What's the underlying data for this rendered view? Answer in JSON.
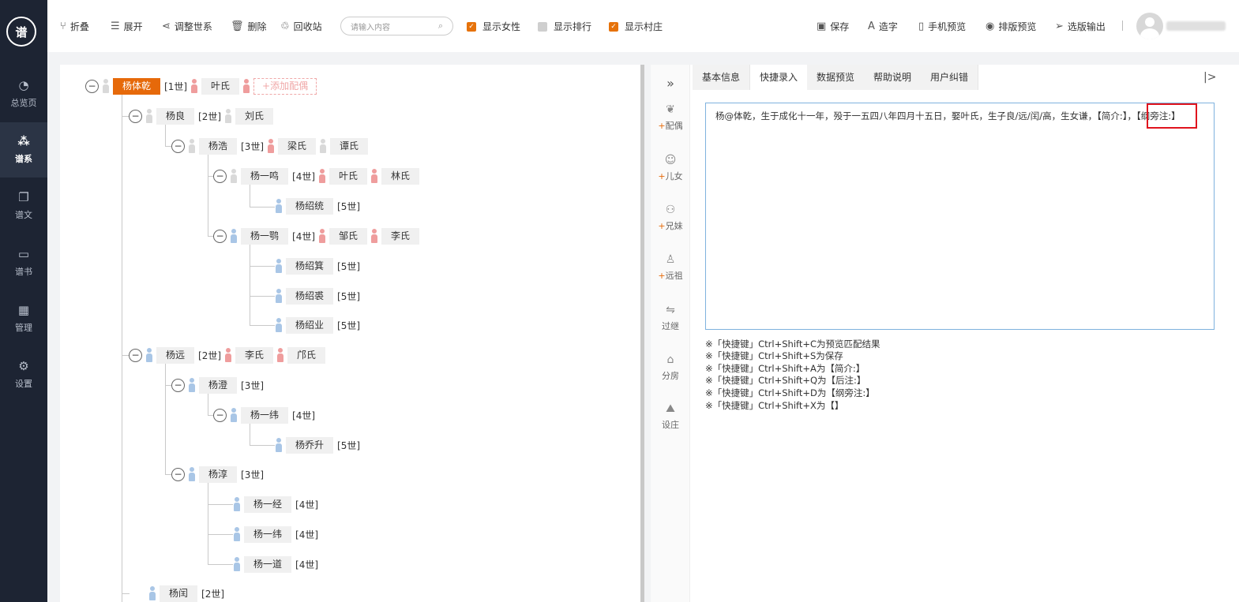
{
  "app": {
    "logo_text": "谱"
  },
  "sidebar": {
    "items": [
      {
        "label": "总览页",
        "icon": "◔"
      },
      {
        "label": "谱系",
        "icon": "⁂"
      },
      {
        "label": "谱文",
        "icon": "❐"
      },
      {
        "label": "谱书",
        "icon": "▭"
      },
      {
        "label": "管理",
        "icon": "▦"
      },
      {
        "label": "设置",
        "icon": "⚙"
      }
    ]
  },
  "toolbar": {
    "fold": "折叠",
    "expand": "展开",
    "adjust": "调整世系",
    "delete": "删除",
    "recycle": "回收站",
    "search_placeholder": "请输入内容",
    "show_female": "显示女性",
    "show_rank": "显示排行",
    "show_village": "显示村庄",
    "save": "保存",
    "make_char": "造字",
    "mobile_preview": "手机预览",
    "layout_preview": "排版预览",
    "select_output": "选版输出"
  },
  "tree": {
    "add_spouse": "+添加配偶",
    "nodes": [
      {
        "name": "杨体乾",
        "gen": "[1世]",
        "spouses": [
          "叶氏"
        ]
      },
      {
        "name": "杨良",
        "gen": "[2世]",
        "spouses": [
          "刘氏"
        ]
      },
      {
        "name": "杨浩",
        "gen": "[3世]",
        "spouses": [
          "梁氏",
          "谭氏"
        ]
      },
      {
        "name": "杨一鸣",
        "gen": "[4世]",
        "spouses": [
          "叶氏",
          "林氏"
        ]
      },
      {
        "name": "杨绍统",
        "gen": "[5世]",
        "spouses": []
      },
      {
        "name": "杨一鹗",
        "gen": "[4世]",
        "spouses": [
          "邹氏",
          "李氏"
        ]
      },
      {
        "name": "杨绍箕",
        "gen": "[5世]",
        "spouses": []
      },
      {
        "name": "杨绍裘",
        "gen": "[5世]",
        "spouses": []
      },
      {
        "name": "杨绍业",
        "gen": "[5世]",
        "spouses": []
      },
      {
        "name": "杨远",
        "gen": "[2世]",
        "spouses": [
          "李氏",
          "邝氏"
        ]
      },
      {
        "name": "杨澄",
        "gen": "[3世]",
        "spouses": []
      },
      {
        "name": "杨一纬",
        "gen": "[4世]",
        "spouses": []
      },
      {
        "name": "杨乔升",
        "gen": "[5世]",
        "spouses": []
      },
      {
        "name": "杨淳",
        "gen": "[3世]",
        "spouses": []
      },
      {
        "name": "杨一经",
        "gen": "[4世]",
        "spouses": []
      },
      {
        "name": "杨一纬",
        "gen": "[4世]",
        "spouses": []
      },
      {
        "name": "杨一道",
        "gen": "[4世]",
        "spouses": []
      },
      {
        "name": "杨闰",
        "gen": "[2世]",
        "spouses": []
      }
    ]
  },
  "tools": [
    {
      "label": "配偶",
      "plus": "+",
      "icon": "❦"
    },
    {
      "label": "儿女",
      "plus": "+",
      "icon": "☺"
    },
    {
      "label": "兄妹",
      "plus": "+",
      "icon": "⚇"
    },
    {
      "label": "远祖",
      "plus": "+",
      "icon": "♙"
    },
    {
      "label": "过继",
      "plus": "",
      "icon": "⇋"
    },
    {
      "label": "分房",
      "plus": "",
      "icon": "⌂"
    },
    {
      "label": "设庄",
      "plus": "",
      "icon": "⛰"
    }
  ],
  "tabs": [
    "基本信息",
    "快捷录入",
    "数据预览",
    "帮助说明",
    "用户纠错"
  ],
  "editor": {
    "content": "杨@体乾，生于成化十一年，殁于一五四八年四月十五日，娶叶氏，生子良/远/闰/高，生女谦，【简介:】，【纲旁注:】"
  },
  "hints": [
    "※「快捷键」Ctrl+Shift+C为预览匹配结果",
    "※「快捷键」Ctrl+Shift+S为保存",
    "※「快捷键」Ctrl+Shift+A为【简介:】",
    "※「快捷键」Ctrl+Shift+Q为【后注:】",
    "※「快捷键」Ctrl+Shift+D为【纲旁注:】",
    "※「快捷键」Ctrl+Shift+X为【】"
  ],
  "colors": {
    "accent": "#e6690a",
    "sidebar": "#1d2433",
    "male": "#a9c6e6",
    "female": "#ef9d9d",
    "highlight": "#e0141e"
  }
}
